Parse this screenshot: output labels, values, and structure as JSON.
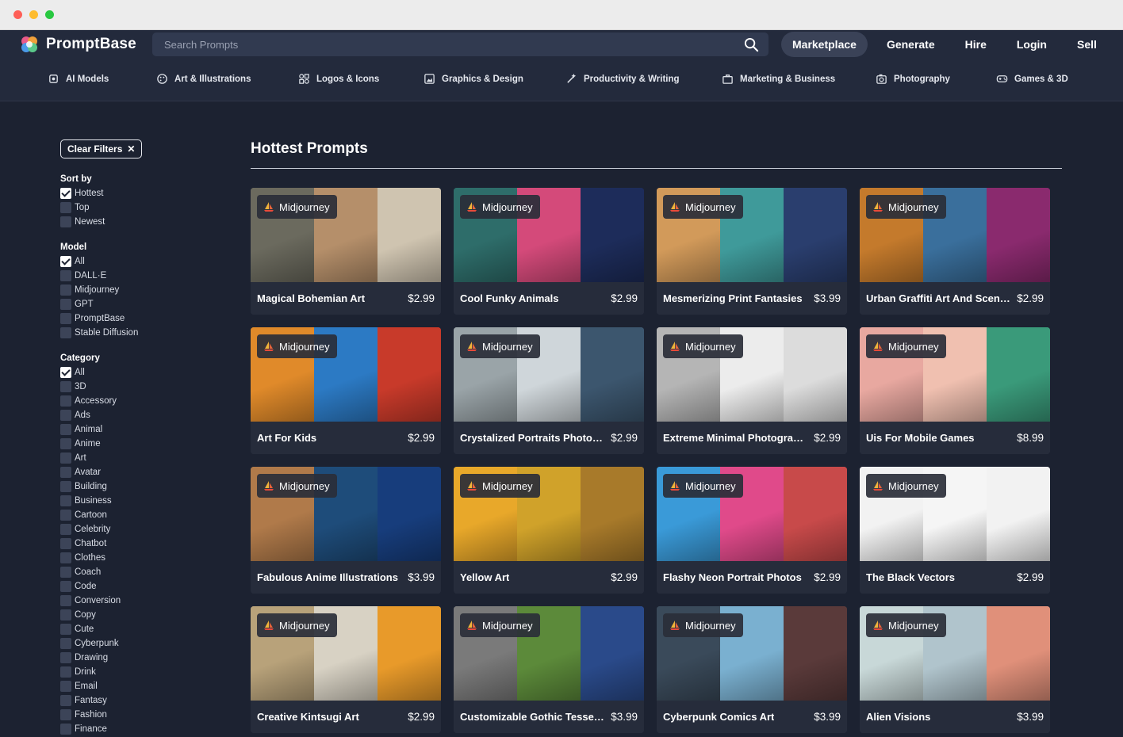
{
  "app": {
    "logo_text": "PromptBase"
  },
  "search": {
    "placeholder": "Search Prompts"
  },
  "topnav": [
    {
      "label": "Marketplace",
      "active": true
    },
    {
      "label": "Generate"
    },
    {
      "label": "Hire"
    },
    {
      "label": "Login"
    },
    {
      "label": "Sell"
    }
  ],
  "categories": [
    {
      "label": "AI Models",
      "icon": "ai-chip-icon"
    },
    {
      "label": "Art & Illustrations",
      "icon": "palette-icon"
    },
    {
      "label": "Logos & Icons",
      "icon": "shapes-icon"
    },
    {
      "label": "Graphics & Design",
      "icon": "image-frame-icon"
    },
    {
      "label": "Productivity & Writing",
      "icon": "magic-wand-icon"
    },
    {
      "label": "Marketing & Business",
      "icon": "briefcase-icon"
    },
    {
      "label": "Photography",
      "icon": "camera-icon"
    },
    {
      "label": "Games & 3D",
      "icon": "gamepad-icon"
    }
  ],
  "filters": {
    "clear_label": "Clear Filters",
    "sort": {
      "heading": "Sort by",
      "options": [
        {
          "label": "Hottest",
          "checked": true
        },
        {
          "label": "Top",
          "checked": false
        },
        {
          "label": "Newest",
          "checked": false
        }
      ]
    },
    "model": {
      "heading": "Model",
      "options": [
        {
          "label": "All",
          "checked": true
        },
        {
          "label": "DALL·E",
          "checked": false
        },
        {
          "label": "Midjourney",
          "checked": false
        },
        {
          "label": "GPT",
          "checked": false
        },
        {
          "label": "PromptBase",
          "checked": false
        },
        {
          "label": "Stable Diffusion",
          "checked": false
        }
      ]
    },
    "category": {
      "heading": "Category",
      "options": [
        {
          "label": "All",
          "checked": true
        },
        {
          "label": "3D"
        },
        {
          "label": "Accessory"
        },
        {
          "label": "Ads"
        },
        {
          "label": "Animal"
        },
        {
          "label": "Anime"
        },
        {
          "label": "Art"
        },
        {
          "label": "Avatar"
        },
        {
          "label": "Building"
        },
        {
          "label": "Business"
        },
        {
          "label": "Cartoon"
        },
        {
          "label": "Celebrity"
        },
        {
          "label": "Chatbot"
        },
        {
          "label": "Clothes"
        },
        {
          "label": "Coach"
        },
        {
          "label": "Code"
        },
        {
          "label": "Conversion"
        },
        {
          "label": "Copy"
        },
        {
          "label": "Cute"
        },
        {
          "label": "Cyberpunk"
        },
        {
          "label": "Drawing"
        },
        {
          "label": "Drink"
        },
        {
          "label": "Email"
        },
        {
          "label": "Fantasy"
        },
        {
          "label": "Fashion"
        },
        {
          "label": "Finance"
        }
      ]
    }
  },
  "main": {
    "title": "Hottest Prompts",
    "cards": [
      {
        "model": "Midjourney",
        "name": "Magical Bohemian Art",
        "price": "$2.99",
        "colors": [
          "#6b6a5e",
          "#b58f6a",
          "#cfc4b0"
        ]
      },
      {
        "model": "Midjourney",
        "name": "Cool Funky Animals",
        "price": "$2.99",
        "colors": [
          "#2e6d6a",
          "#d44a7a",
          "#1d2c5a"
        ]
      },
      {
        "model": "Midjourney",
        "name": "Mesmerizing Print Fantasies",
        "price": "$3.99",
        "colors": [
          "#d29a5a",
          "#3f9a9a",
          "#2a3e6e"
        ]
      },
      {
        "model": "Midjourney",
        "name": "Urban Graffiti Art And Sceneri…",
        "price": "$2.99",
        "colors": [
          "#c47a2c",
          "#3a6f9c",
          "#8a2a6e"
        ]
      },
      {
        "model": "Midjourney",
        "name": "Art For Kids",
        "price": "$2.99",
        "colors": [
          "#e08a2a",
          "#2c7ac4",
          "#c83a2a"
        ]
      },
      {
        "model": "Midjourney",
        "name": "Crystalized Portraits Photoma…",
        "price": "$2.99",
        "colors": [
          "#9aa4a8",
          "#cfd6da",
          "#3c566e"
        ]
      },
      {
        "model": "Midjourney",
        "name": "Extreme Minimal Photographs",
        "price": "$2.99",
        "colors": [
          "#b5b5b5",
          "#ececec",
          "#dcdcdc"
        ]
      },
      {
        "model": "Midjourney",
        "name": "Uis For Mobile Games",
        "price": "$8.99",
        "colors": [
          "#e8a8a0",
          "#f0c0b0",
          "#3a9a7a"
        ]
      },
      {
        "model": "Midjourney",
        "name": "Fabulous Anime Illustrations",
        "price": "$3.99",
        "colors": [
          "#b07a4a",
          "#1e4c7a",
          "#173d7c"
        ]
      },
      {
        "model": "Midjourney",
        "name": "Yellow Art",
        "price": "$2.99",
        "colors": [
          "#e8a82a",
          "#d0a22a",
          "#a87a2a"
        ]
      },
      {
        "model": "Midjourney",
        "name": "Flashy Neon Portrait Photos",
        "price": "$2.99",
        "colors": [
          "#3a9ad8",
          "#e04a8a",
          "#c84a4a"
        ]
      },
      {
        "model": "Midjourney",
        "name": "The Black Vectors",
        "price": "$2.99",
        "colors": [
          "#f2f2f2",
          "#f5f5f5",
          "#f2f2f2"
        ]
      },
      {
        "model": "Midjourney",
        "name": "Creative Kintsugi Art",
        "price": "$2.99",
        "colors": [
          "#b8a27a",
          "#d8d2c4",
          "#e89a2a"
        ]
      },
      {
        "model": "Midjourney",
        "name": "Customizable Gothic Tessellat…",
        "price": "$3.99",
        "colors": [
          "#7a7a7a",
          "#5c8a3a",
          "#2a4a8a"
        ]
      },
      {
        "model": "Midjourney",
        "name": "Cyberpunk Comics Art",
        "price": "$3.99",
        "colors": [
          "#3a4a5a",
          "#7ab0d0",
          "#5a3a3a"
        ]
      },
      {
        "model": "Midjourney",
        "name": "Alien Visions",
        "price": "$3.99",
        "colors": [
          "#c8d8d8",
          "#b0c4cc",
          "#e0907a"
        ]
      }
    ]
  }
}
